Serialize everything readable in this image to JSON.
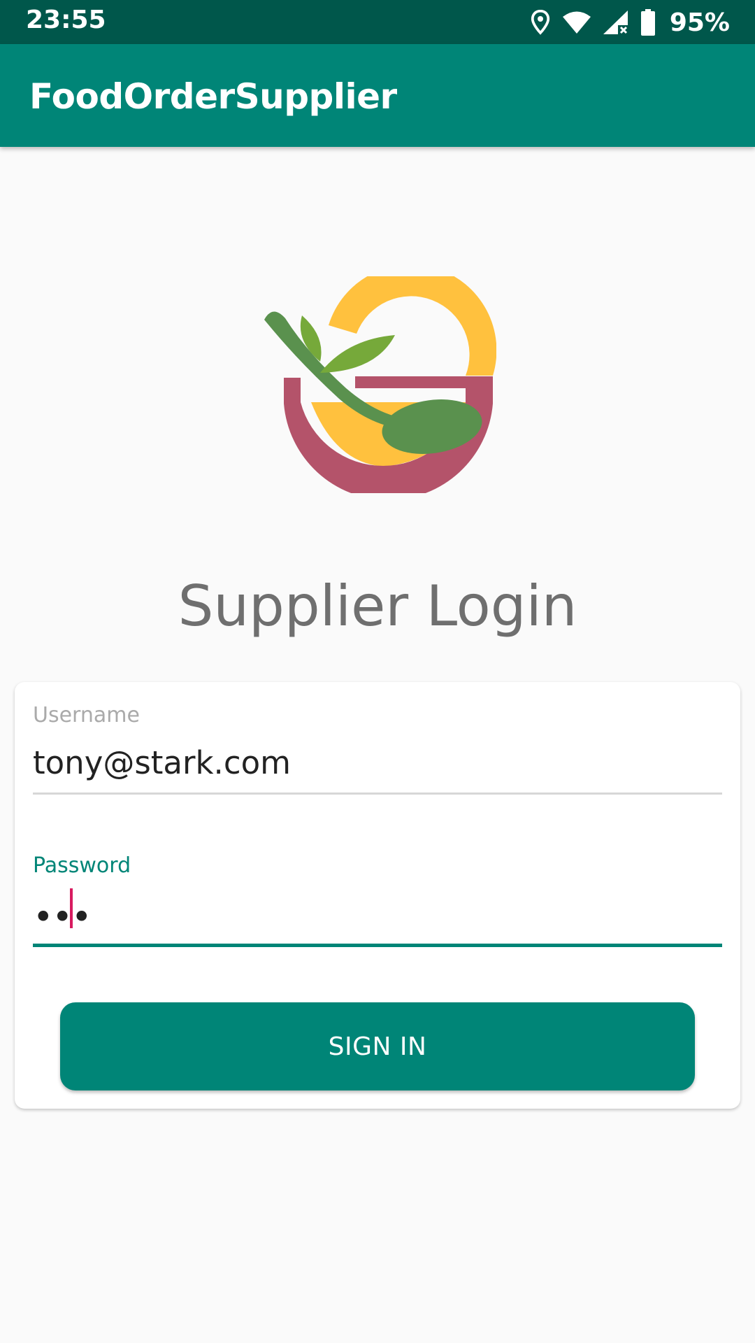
{
  "status_bar": {
    "time": "23:55",
    "battery": "95%",
    "icons": [
      "location-icon",
      "wifi-icon",
      "cellular-no-data-icon",
      "battery-icon"
    ]
  },
  "app_bar": {
    "title": "FoodOrderSupplier"
  },
  "logo": {
    "name": "food-bowl-spoon-leaves-logo",
    "colors": {
      "yellow": "#FFC13E",
      "maroon": "#B4536A",
      "green": "#5A914E",
      "leaf": "#76A93A"
    }
  },
  "login": {
    "title": "Supplier Login",
    "username_label": "Username",
    "username_value": "tony@stark.com",
    "password_label": "Password",
    "password_masked": "•••",
    "sign_in_label": "SIGN IN"
  },
  "colors": {
    "primary": "#008577",
    "primary_dark": "#00574B",
    "accent": "#D81B60",
    "background": "#FAFAFA"
  }
}
